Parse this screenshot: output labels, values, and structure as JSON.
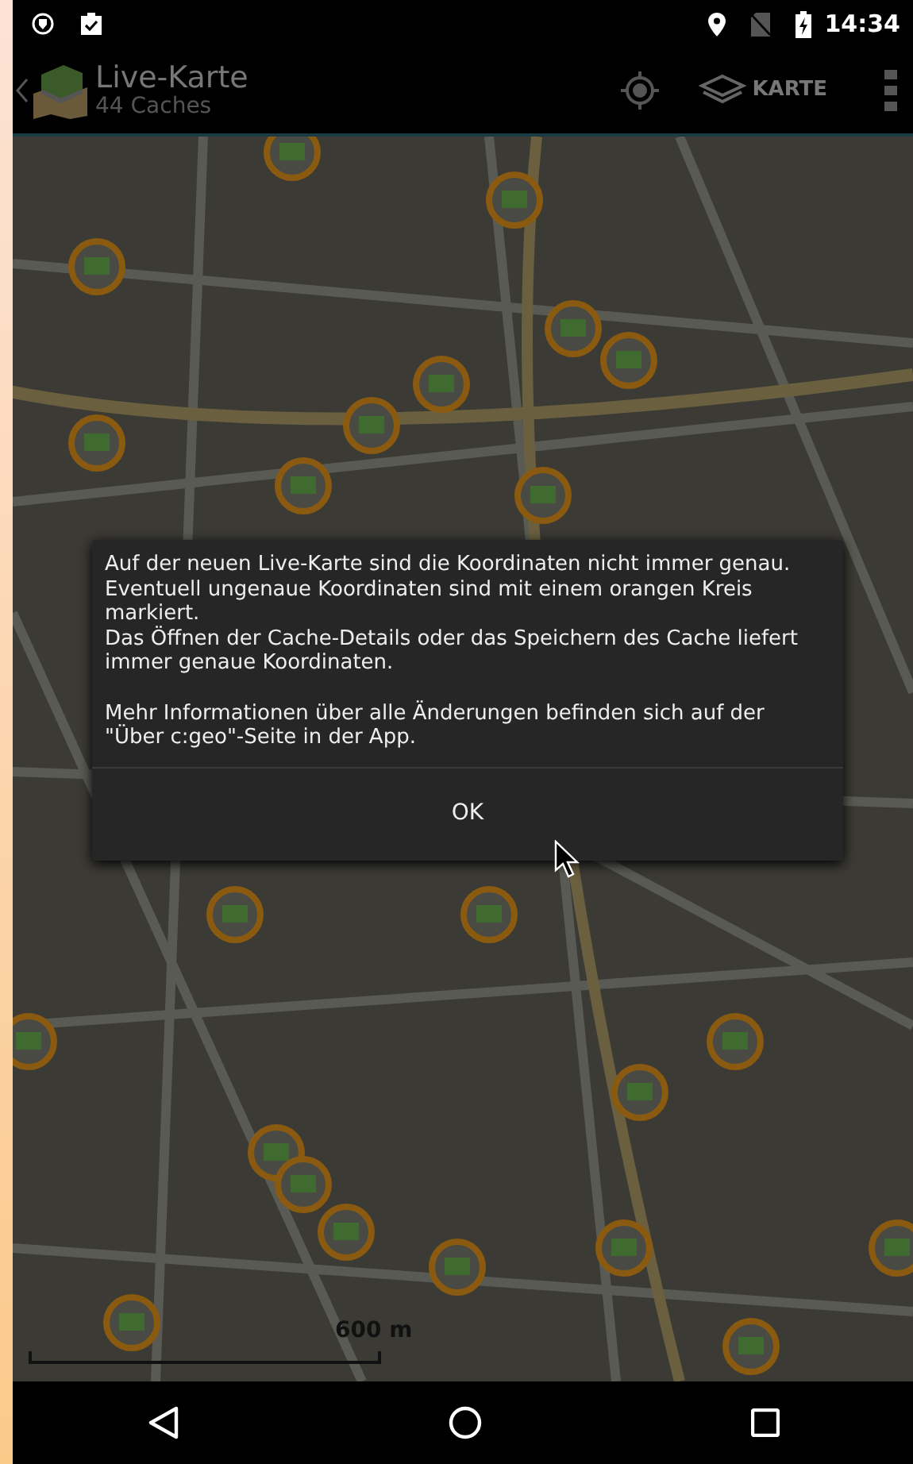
{
  "status_bar": {
    "time": "14:34"
  },
  "app_bar": {
    "title": "Live-Karte",
    "subtitle": "44 Caches",
    "map_source_button": "KARTE"
  },
  "map": {
    "scale_label": "600 m"
  },
  "dialog": {
    "message": "Auf der neuen Live-Karte sind die Koordinaten nicht immer genau. Eventuell ungenaue Koordinaten sind mit einem orangen Kreis markiert.\nDas Öffnen der Cache-Details oder das Speichern des Cache liefert immer genaue Koordinaten.\n\nMehr Informationen über alle Änderungen befinden sich auf der \"Über c:geo\"-Seite in der App.",
    "button": "OK"
  }
}
